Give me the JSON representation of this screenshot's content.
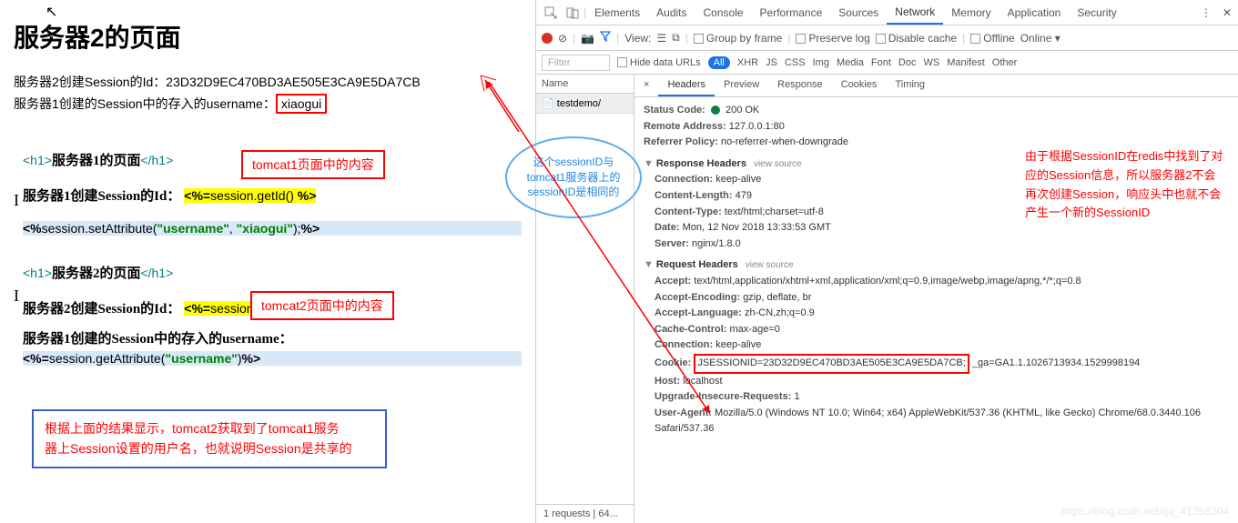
{
  "left": {
    "title": "服务器2的页面",
    "line1_label": "服务器2创建Session的Id：",
    "line1_val": "23D32D9EC470BD3AE505E3CA9E5DA7CB",
    "line2_label": "服务器1创建的Session中的存入的username：",
    "line2_val": "xiaogui",
    "code1_h1": "服务器1的页面",
    "label_box1": "tomcat1页面中的内容",
    "code1_lbl": "服务器1创建Session的Id：",
    "code_getid": "session.getId()",
    "code_setattr": "session.setAttribute",
    "attr_k": "\"username\"",
    "attr_v": "\"xiaogui\"",
    "code2_h1": "服务器2的页面",
    "label_box2": "tomcat2页面中的内容",
    "code2_lbl": "服务器2创建Session的Id：",
    "code3_lbl": "服务器1创建的Session中的存入的username：",
    "code_getattr": "session.getAttribute",
    "attr_k2": "\"username\"",
    "blue_note_l1": "根据上面的结果显示，tomcat2获取到了tomcat1服务",
    "blue_note_l2": "器上Session设置的用户名，也就说明Session是共享的",
    "ellipse_l1": "这个sessionID与",
    "ellipse_l2": "tomcat1服务器上的",
    "ellipse_l3": "sessionID是相同的"
  },
  "devtools": {
    "tabs": [
      "Elements",
      "Audits",
      "Console",
      "Performance",
      "Sources",
      "Network",
      "Memory",
      "Application",
      "Security"
    ],
    "toolbar": {
      "view": "View:",
      "group": "Group by frame",
      "preserve": "Preserve log",
      "disable": "Disable cache",
      "offline": "Offline",
      "online": "Online"
    },
    "filter": {
      "placeholder": "Filter",
      "hide": "Hide data URLs",
      "all": "All",
      "types": [
        "XHR",
        "JS",
        "CSS",
        "Img",
        "Media",
        "Font",
        "Doc",
        "WS",
        "Manifest",
        "Other"
      ]
    },
    "name_hdr": "Name",
    "req_item": "testdemo/",
    "subtabs": [
      "Headers",
      "Preview",
      "Response",
      "Cookies",
      "Timing"
    ],
    "status": {
      "k": "Status Code:",
      "v": "200 OK"
    },
    "remote": {
      "k": "Remote Address:",
      "v": "127.0.0.1:80"
    },
    "referrer": {
      "k": "Referrer Policy:",
      "v": "no-referrer-when-downgrade"
    },
    "resp_hdr": "Response Headers",
    "resp": {
      "conn": {
        "k": "Connection:",
        "v": "keep-alive"
      },
      "clen": {
        "k": "Content-Length:",
        "v": "479"
      },
      "ctype": {
        "k": "Content-Type:",
        "v": "text/html;charset=utf-8"
      },
      "date": {
        "k": "Date:",
        "v": "Mon, 12 Nov 2018 13:33:53 GMT"
      },
      "server": {
        "k": "Server:",
        "v": "nginx/1.8.0"
      }
    },
    "req_hdr": "Request Headers",
    "req": {
      "accept": {
        "k": "Accept:",
        "v": "text/html,application/xhtml+xml,application/xml;q=0.9,image/webp,image/apng,*/*;q=0.8"
      },
      "aenc": {
        "k": "Accept-Encoding:",
        "v": "gzip, deflate, br"
      },
      "alang": {
        "k": "Accept-Language:",
        "v": "zh-CN,zh;q=0.9"
      },
      "cache": {
        "k": "Cache-Control:",
        "v": "max-age=0"
      },
      "conn": {
        "k": "Connection:",
        "v": "keep-alive"
      },
      "cookie": {
        "k": "Cookie:",
        "v": "JSESSIONID=23D32D9EC470BD3AE505E3CA9E5DA7CB;",
        "v2": "_ga=GA1.1.1026713934.1529998194"
      },
      "host": {
        "k": "Host:",
        "v": "localhost"
      },
      "upg": {
        "k": "Upgrade-Insecure-Requests:",
        "v": "1"
      },
      "ua": {
        "k": "User-Agent:",
        "v": "Mozilla/5.0 (Windows NT 10.0; Win64; x64) AppleWebKit/537.36 (KHTML, like Gecko) Chrome/68.0.3440.106 Safari/537.36"
      }
    },
    "red_note_l1": "由于根据SessionID在redis中找到了对",
    "red_note_l2": "应的Session信息，所以服务器2不会",
    "red_note_l3": "再次创建Session，响应头中也就不会",
    "red_note_l4": "产生一个新的SessionID",
    "bottom": "1 requests | 64...",
    "view_source": "view source"
  },
  "watermark": "https://blog.csdn.net/qq_41258204"
}
